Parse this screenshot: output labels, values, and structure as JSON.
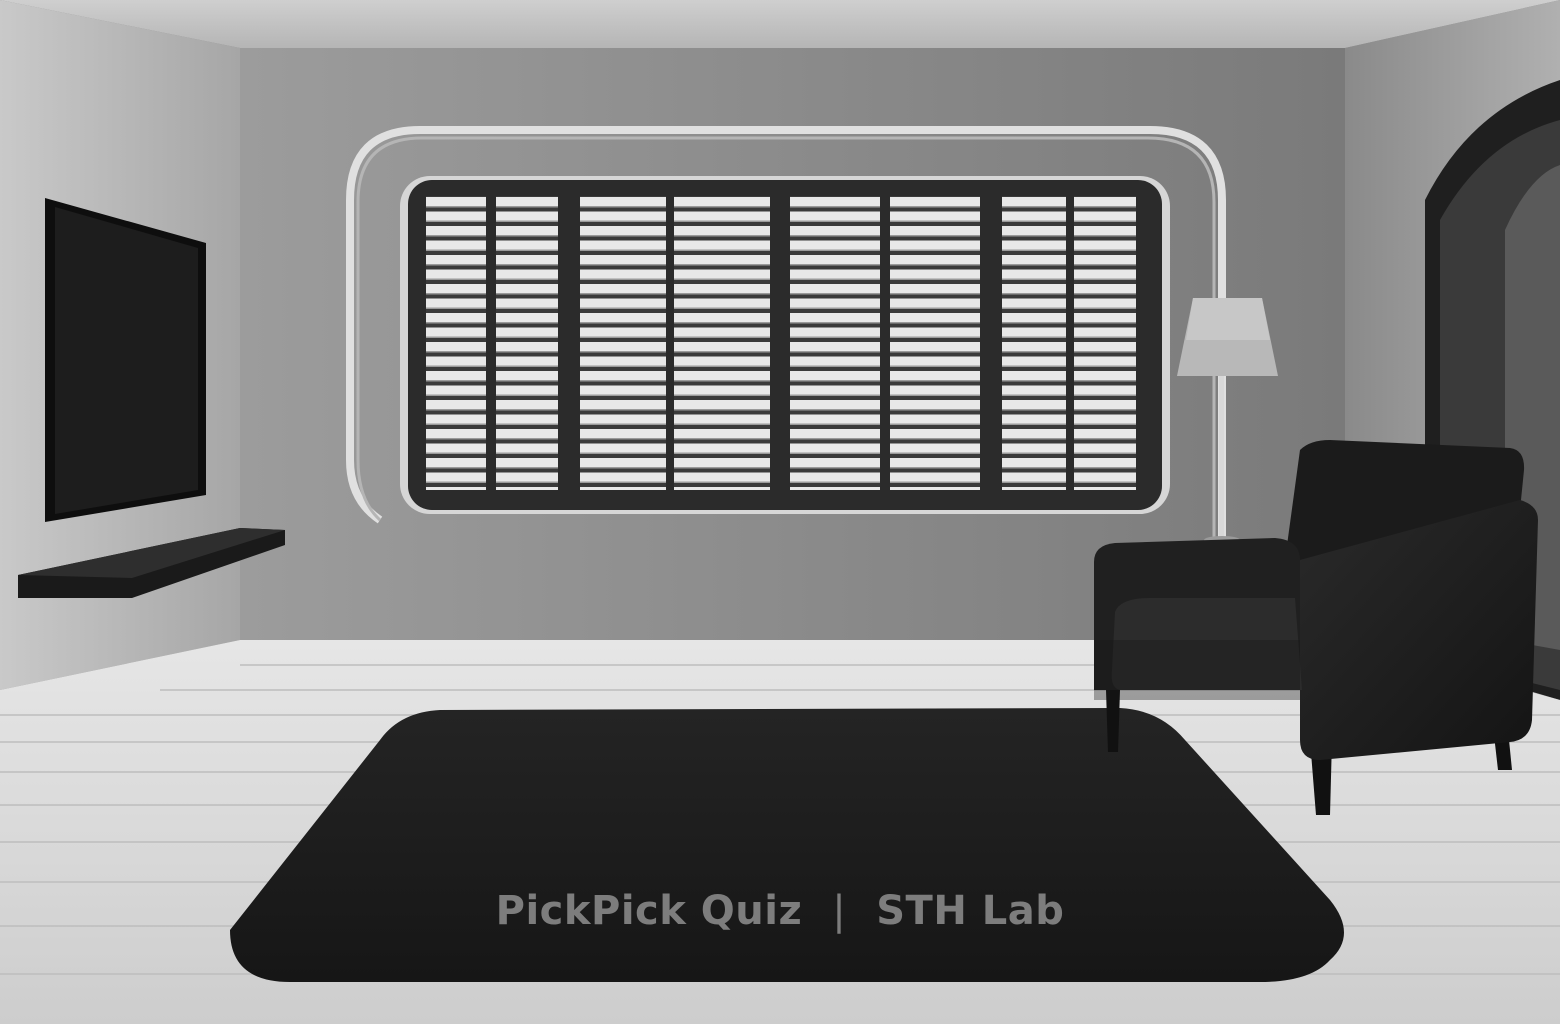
{
  "watermark": {
    "quiz": "PickPick Quiz",
    "separator": "|",
    "lab": "STH Lab"
  },
  "colors": {
    "wall": "#8f8f8f",
    "side_wall": "#bdbdbd",
    "floor": "#d8d8d8",
    "furniture": "#1c1c1c",
    "blinds": "#e6e6e6"
  }
}
